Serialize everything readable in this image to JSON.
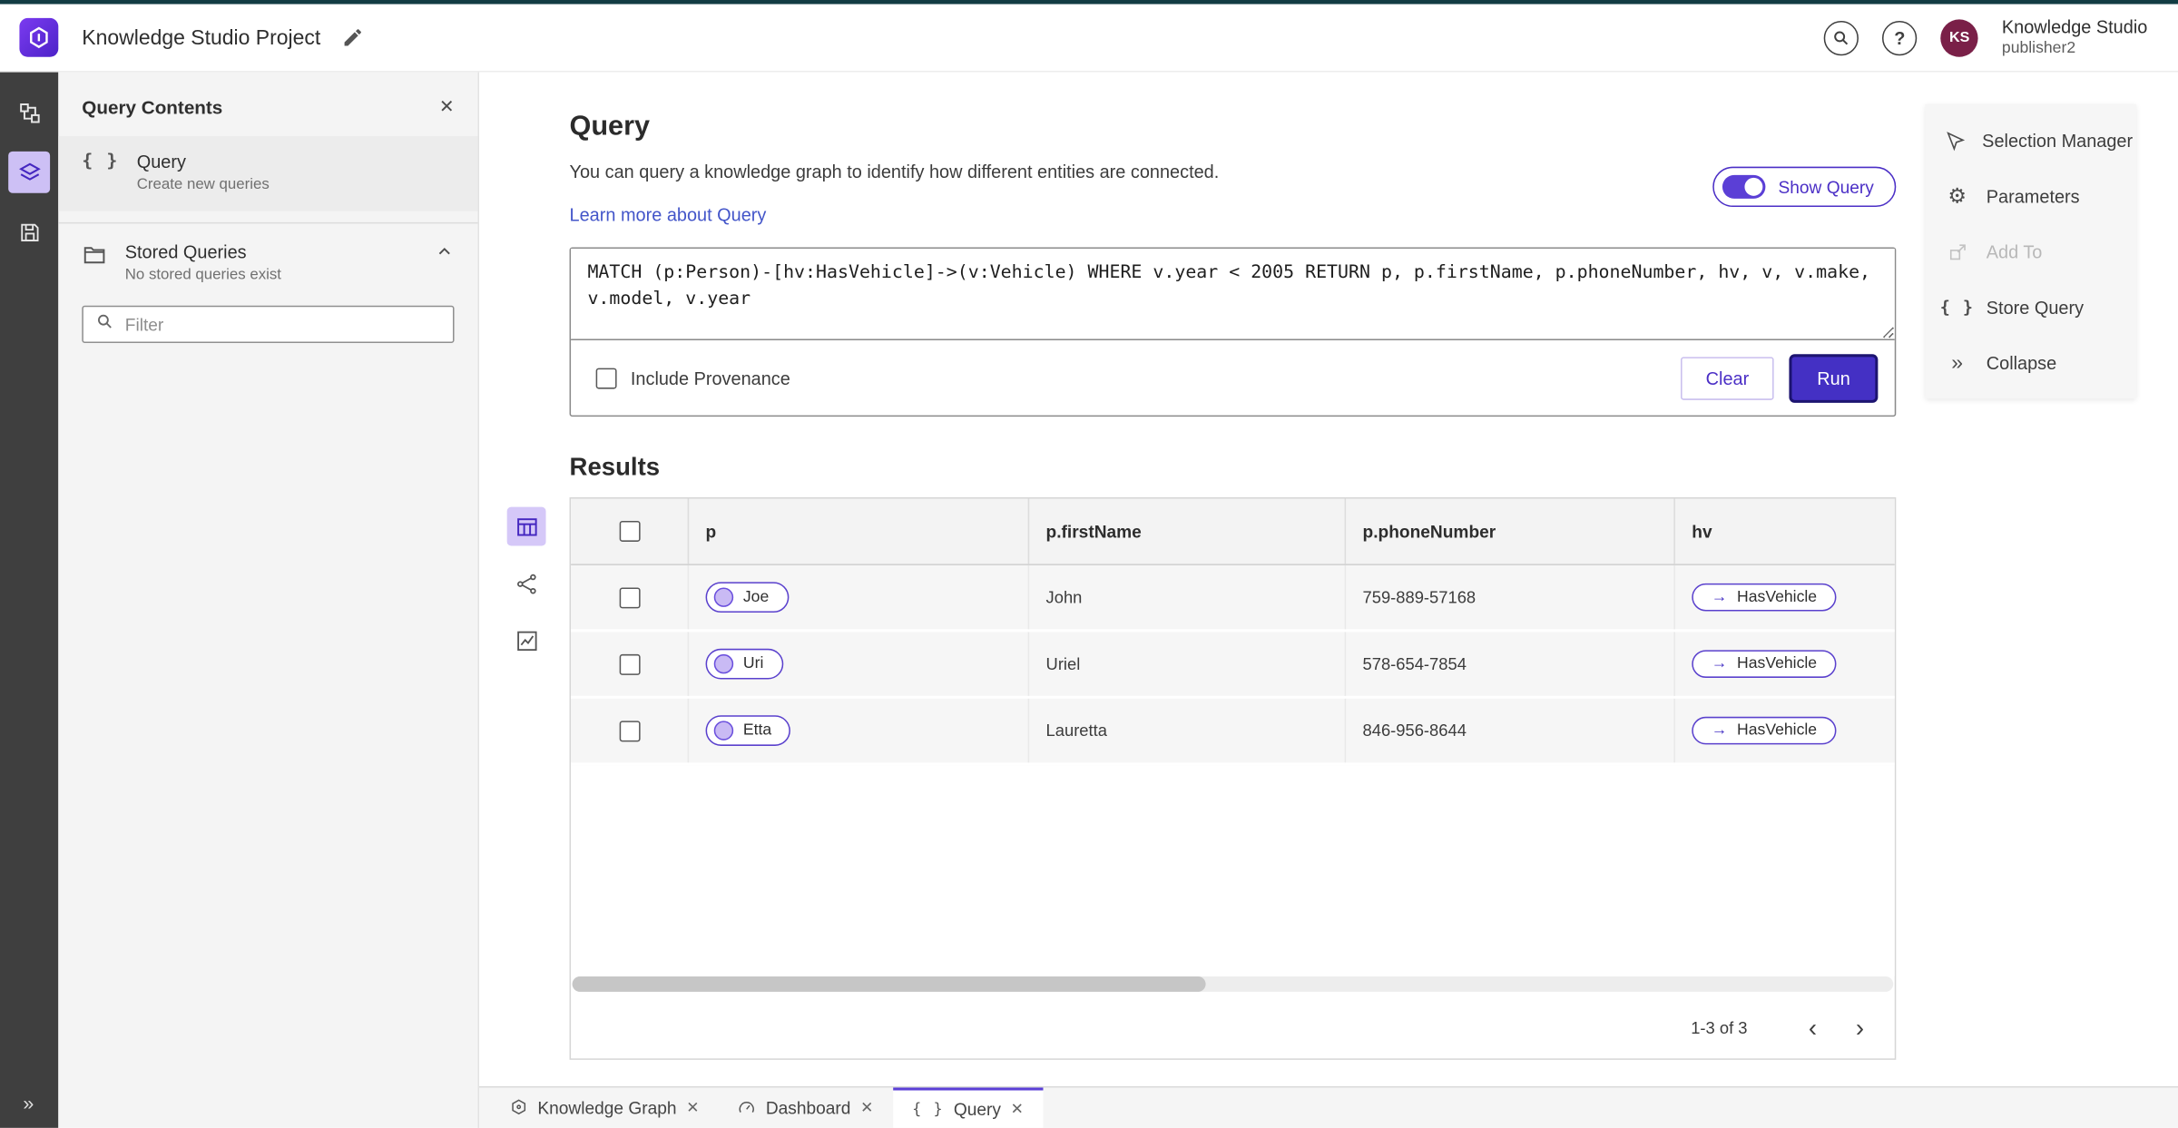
{
  "header": {
    "title": "Knowledge Studio Project",
    "app_name": "Knowledge Studio",
    "username": "publisher2",
    "avatar": "KS"
  },
  "panel": {
    "title": "Query Contents",
    "query_item": {
      "label": "Query",
      "description": "Create new queries"
    },
    "stored_queries": {
      "label": "Stored Queries",
      "description": "No stored queries exist"
    },
    "filter_placeholder": "Filter"
  },
  "query": {
    "title": "Query",
    "description": "You can query a knowledge graph to identify how different entities are connected.",
    "learn_more": "Learn more about Query",
    "show_query": "Show Query",
    "text": "MATCH (p:Person)-[hv:HasVehicle]->(v:Vehicle) WHERE v.year < 2005 RETURN p, p.firstName, p.phoneNumber, hv, v, v.make, v.model, v.year",
    "include_provenance": "Include Provenance",
    "clear": "Clear",
    "run": "Run"
  },
  "results": {
    "title": "Results",
    "columns": [
      "p",
      "p.firstName",
      "p.phoneNumber",
      "hv"
    ],
    "rows": [
      {
        "p": "Joe",
        "firstName": "John",
        "phoneNumber": "759-889-57168",
        "hv": "HasVehicle"
      },
      {
        "p": "Uri",
        "firstName": "Uriel",
        "phoneNumber": "578-654-7854",
        "hv": "HasVehicle"
      },
      {
        "p": "Etta",
        "firstName": "Lauretta",
        "phoneNumber": "846-956-8644",
        "hv": "HasVehicle"
      }
    ],
    "pagination": "1-3 of 3"
  },
  "menu": {
    "selection_manager": "Selection Manager",
    "parameters": "Parameters",
    "add_to": "Add To",
    "store_query": "Store Query",
    "collapse": "Collapse"
  },
  "tabs": [
    {
      "label": "Knowledge Graph"
    },
    {
      "label": "Dashboard"
    },
    {
      "label": "Query"
    }
  ],
  "icons": {
    "braces": "{ }",
    "question_mark": "?",
    "close": "✕",
    "arrow_right": "→",
    "double_chevron_right": "»",
    "gear": "⚙",
    "chevron_left": "‹",
    "chevron_right": "›"
  },
  "colors": {
    "accent": "#4430c4",
    "link": "#4355c9",
    "node_fill": "#c9baf4",
    "rail_selected_bg": "#cdc0f5"
  }
}
